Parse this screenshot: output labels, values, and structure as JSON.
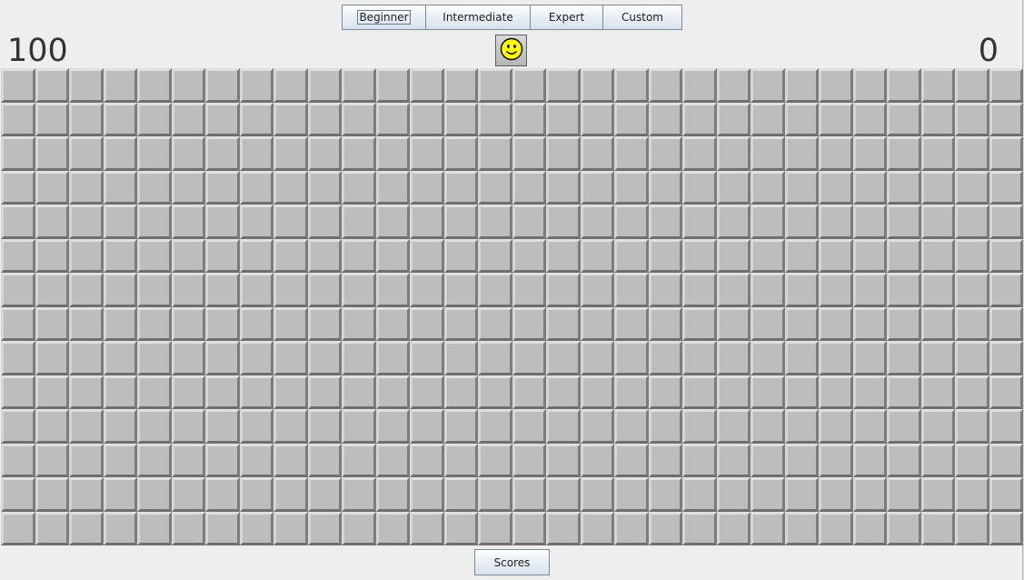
{
  "toolbar": {
    "buttons": [
      {
        "id": "beginner",
        "label": "Beginner",
        "focused": true
      },
      {
        "id": "intermediate",
        "label": "Intermediate",
        "focused": false
      },
      {
        "id": "expert",
        "label": "Expert",
        "focused": false
      },
      {
        "id": "custom",
        "label": "Custom",
        "focused": false
      }
    ]
  },
  "header": {
    "mine_counter": "100",
    "timer": "0",
    "smiley_icon": "smiley-face-icon"
  },
  "board": {
    "rows": 14,
    "cols": 30,
    "cell_state": "unrevealed"
  },
  "footer": {
    "scores_label": "Scores"
  },
  "colors": {
    "cell_face": "#bdbdbd",
    "background": "#eeeeee",
    "smiley_yellow": "#ffff00"
  }
}
